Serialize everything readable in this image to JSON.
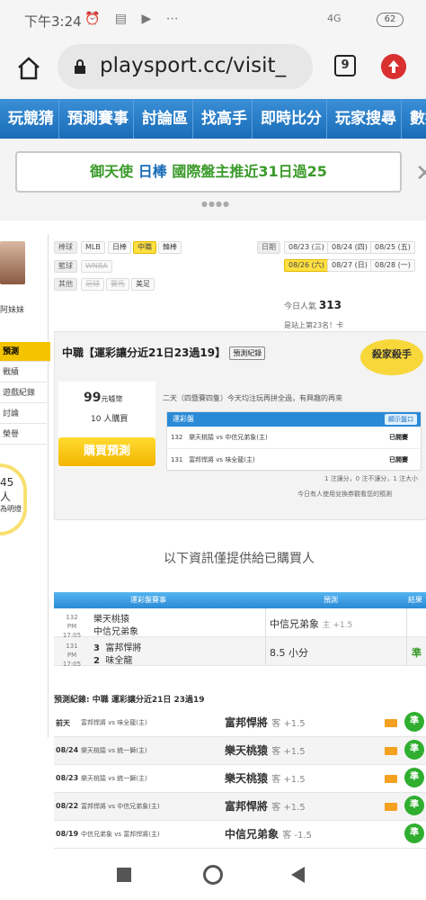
{
  "status": {
    "time": "下午3:24",
    "icons": "⏰ ▤ ▶ ⋯",
    "signal": "4G",
    "battery": "62"
  },
  "browser": {
    "url": "playsport.cc/visit_",
    "tabs": "9"
  },
  "nav": [
    "玩競猜",
    "預測賽事",
    "討論區",
    "找高手",
    "即時比分",
    "玩家搜尋",
    "數據"
  ],
  "banner": {
    "pre": "御天使",
    "mid": "日棒",
    "post": "國際盤主推近31日過25",
    "close": "✕"
  },
  "sidebar": {
    "name": "阿妹妹",
    "items": [
      "預測",
      "戰績",
      "遊戲紀錄",
      "討論",
      "榮譽"
    ],
    "bulb": "45 人",
    "bulb2": "為明燈"
  },
  "filters": {
    "row1": {
      "label": "棒球",
      "opts": [
        "MLB",
        "日棒",
        "中職",
        "韓棒"
      ]
    },
    "row2": {
      "label": "籃球",
      "opts": [
        "WNBA"
      ]
    },
    "row3": {
      "label": "其他",
      "opts": [
        "足球",
        "賽馬",
        "美足"
      ]
    },
    "date_label": "日期",
    "dates": [
      "08/23 (三)",
      "08/24 (四)",
      "08/25 (五)",
      "08/26 (六)",
      "08/27 (日)",
      "08/28 (一)"
    ]
  },
  "popular": {
    "label": "今日人氣",
    "value": "313",
    "rank": "是站上第23名！卡"
  },
  "card": {
    "title": "中職【運彩讓分近21日23過19】",
    "record_btn": "預測紀錄",
    "stamp": "殺家殺手",
    "price": "99",
    "price_unit": "元噱幣",
    "buyers": "10 人購買",
    "buy": "購買預測",
    "note1": "二天（四暨賽四隻）今天均注玩再拼全過，有興趣的再來",
    "pick_head": "運彩盤",
    "pick_show": "顯示盤口",
    "picks": [
      {
        "num": "132",
        "away": "樂天桃猿",
        "home": "中信兄弟象(主)",
        "status": "已開賽"
      },
      {
        "num": "131",
        "away": "富邦悍將",
        "home": "味全龍(主)",
        "status": "已開賽"
      }
    ],
    "note2": "1 注讓分，0 注不讓分，1 注大小",
    "note3": "今日有人使用兌換券觀看您的預測"
  },
  "info_head": "以下資訊僅提供給已購買人",
  "table": {
    "headers": [
      "運彩盤賽事",
      "預測",
      "結果"
    ],
    "rows": [
      {
        "num": "132",
        "time": "PM 17:05",
        "s1": "",
        "t1": "樂天桃猿",
        "s2": "",
        "t2": "中信兄弟象",
        "pick": "中信兄弟象",
        "pick_sub": "主 +1.5",
        "res": ""
      },
      {
        "num": "131",
        "time": "PM 17:05",
        "s1": "3",
        "t1": "富邦悍將",
        "s2": "2",
        "t2": "味全龍",
        "pick": "8.5 小分",
        "pick_sub": "",
        "res": "準"
      }
    ]
  },
  "history": {
    "title": "預測紀錄: 中職 運彩讓分近21日 23過19",
    "rows": [
      {
        "date": "前天",
        "game": "富邦悍將 vs 味全龍(主)",
        "pick": "富邦悍將",
        "sub": "客 +1.5",
        "res": "準"
      },
      {
        "date": "08/24",
        "game": "樂天桃猿 vs 統一獅(主)",
        "pick": "樂天桃猿",
        "sub": "客 +1.5",
        "res": "準"
      },
      {
        "date": "08/23",
        "game": "樂天桃猿 vs 統一獅(主)",
        "pick": "樂天桃猿",
        "sub": "客 +1.5",
        "res": "準"
      },
      {
        "date": "08/22",
        "game": "富邦悍將 vs 中信兄弟象(主)",
        "pick": "富邦悍將",
        "sub": "客 +1.5",
        "res": "準"
      },
      {
        "date": "08/19",
        "game": "中信兄弟象 vs 富邦悍將(主)",
        "pick": "中信兄弟象",
        "sub": "客 -1.5",
        "res": "準"
      }
    ]
  }
}
